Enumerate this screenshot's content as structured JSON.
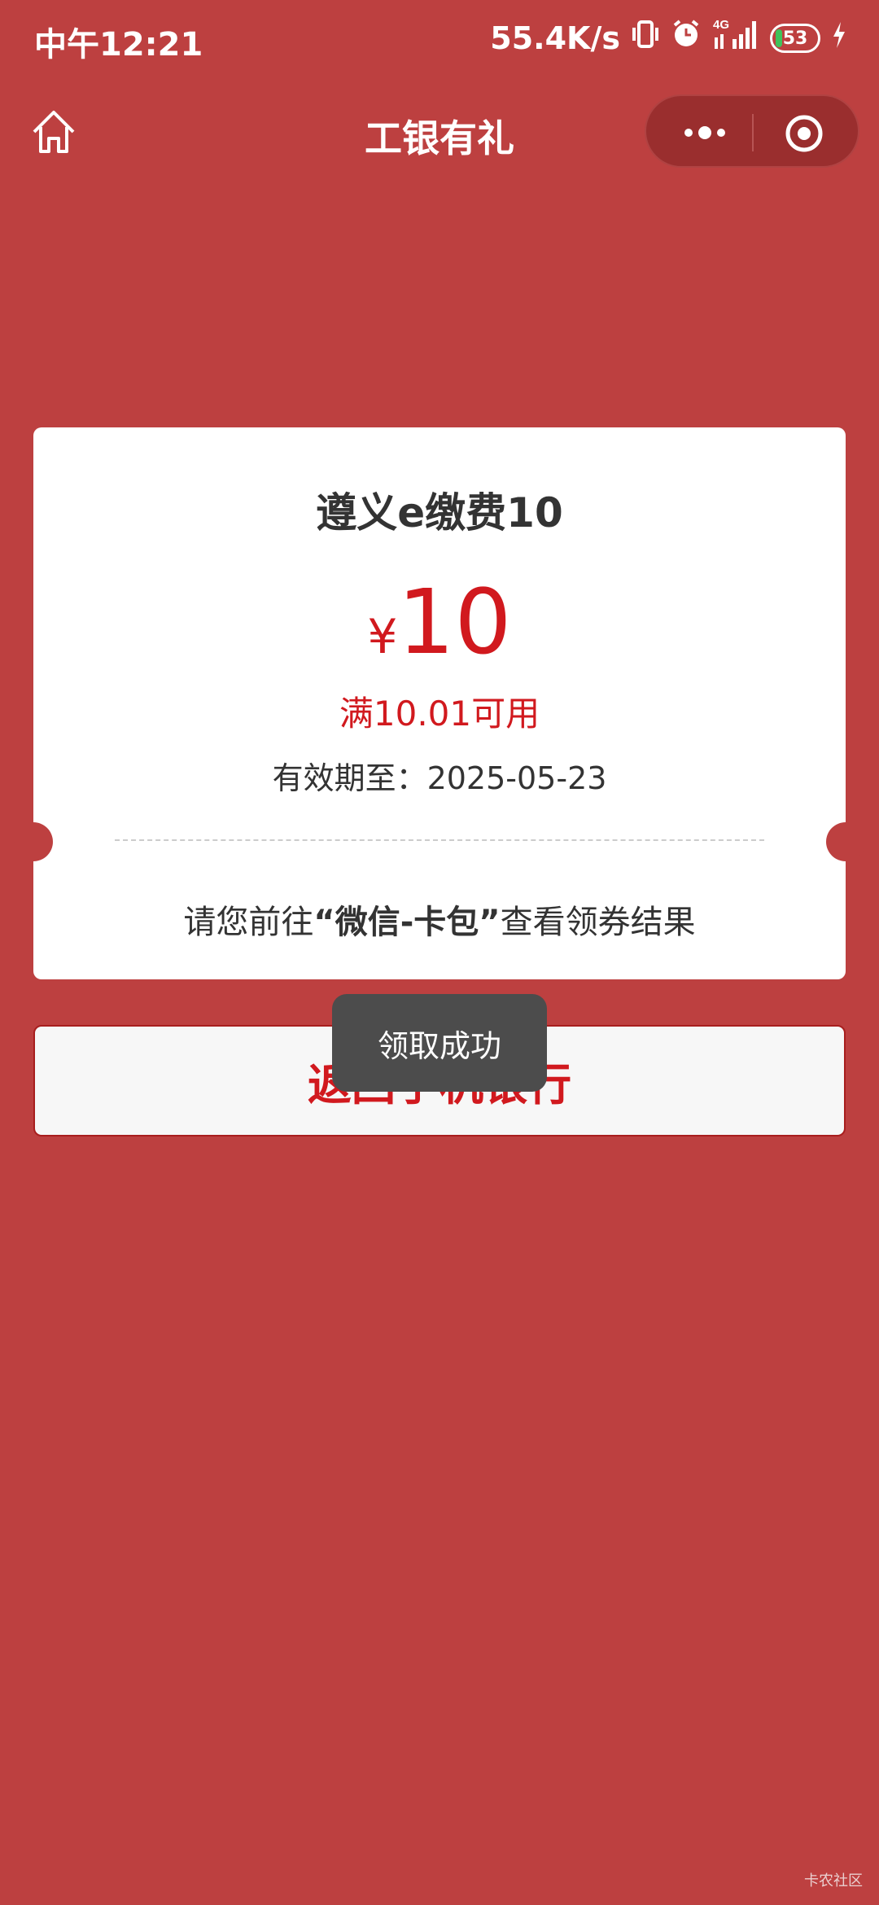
{
  "status_bar": {
    "time": "中午12:21",
    "net_speed": "55.4K/s",
    "network": "4G",
    "battery": "53",
    "icons": [
      "vibrate-icon",
      "alarm-icon",
      "signal-icon",
      "battery-icon",
      "charging-icon"
    ]
  },
  "nav": {
    "title": "工银有礼",
    "icons": [
      "home-icon",
      "more-icon",
      "close-miniprogram-icon"
    ]
  },
  "coupon": {
    "title": "遵义e缴费10",
    "currency": "¥",
    "amount": "10",
    "condition": "满10.01可用",
    "validity_label": "有效期至：",
    "validity_date": "2025-05-23",
    "note_prefix": "请您前往",
    "note_highlight": "“微信-卡包”",
    "note_suffix": "查看领券结果"
  },
  "return_button": {
    "label": "返回手机银行"
  },
  "toast": {
    "message": "领取成功"
  },
  "watermark": "卡农社区",
  "colors": {
    "background": "#bd4040",
    "accent_red": "#d1191e",
    "toast_bg": "#4c4c4c"
  }
}
